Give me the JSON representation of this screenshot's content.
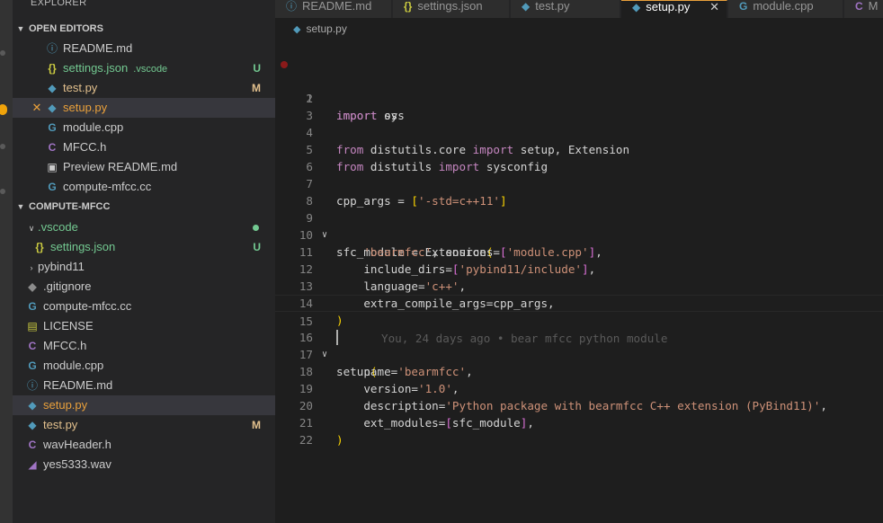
{
  "explorer": {
    "title": "EXPLORER",
    "open_editors_title": "OPEN EDITORS",
    "project_title": "COMPUTE-MFCC",
    "open_editors": [
      {
        "label": "README.md",
        "icon": "info-icon",
        "hint": "",
        "badge": ""
      },
      {
        "label": "settings.json",
        "icon": "json-braces-icon",
        "hint": ".vscode",
        "badge": "U"
      },
      {
        "label": "test.py",
        "icon": "python-icon",
        "hint": "",
        "badge": "M"
      },
      {
        "label": "setup.py",
        "icon": "python-icon",
        "hint": "",
        "badge": ""
      },
      {
        "label": "module.cpp",
        "icon": "cpp-icon",
        "hint": "",
        "badge": ""
      },
      {
        "label": "MFCC.h",
        "icon": "c-header-icon",
        "hint": "",
        "badge": ""
      },
      {
        "label": "Preview README.md",
        "icon": "preview-icon",
        "hint": "",
        "badge": ""
      },
      {
        "label": "compute-mfcc.cc",
        "icon": "cpp-icon",
        "hint": "",
        "badge": ""
      }
    ],
    "files": [
      {
        "label": ".vscode",
        "icon": "chevron-down-icon",
        "badge": ""
      },
      {
        "label": "settings.json",
        "icon": "json-braces-icon",
        "badge": "U"
      },
      {
        "label": "pybind11",
        "icon": "chevron-right-icon",
        "badge": ""
      },
      {
        "label": ".gitignore",
        "icon": "git-icon",
        "badge": ""
      },
      {
        "label": "compute-mfcc.cc",
        "icon": "cpp-icon",
        "badge": ""
      },
      {
        "label": "LICENSE",
        "icon": "license-icon",
        "badge": ""
      },
      {
        "label": "MFCC.h",
        "icon": "c-header-icon",
        "badge": ""
      },
      {
        "label": "module.cpp",
        "icon": "cpp-icon",
        "badge": ""
      },
      {
        "label": "README.md",
        "icon": "info-icon",
        "badge": ""
      },
      {
        "label": "setup.py",
        "icon": "python-icon",
        "badge": ""
      },
      {
        "label": "test.py",
        "icon": "python-icon",
        "badge": "M"
      },
      {
        "label": "wavHeader.h",
        "icon": "c-header-icon",
        "badge": ""
      },
      {
        "label": "yes5333.wav",
        "icon": "audio-icon",
        "badge": ""
      }
    ]
  },
  "tabs": [
    {
      "label": "README.md",
      "icon": "info-icon"
    },
    {
      "label": "settings.json",
      "icon": "json-braces-icon"
    },
    {
      "label": "test.py",
      "icon": "python-icon"
    },
    {
      "label": "setup.py",
      "icon": "python-icon",
      "active": true
    },
    {
      "label": "module.cpp",
      "icon": "cpp-icon"
    },
    {
      "label": "M",
      "icon": "c-header-icon"
    }
  ],
  "breadcrumb": {
    "file": "setup.py"
  },
  "editor": {
    "line_numbers": [
      "1",
      "2",
      "3",
      "4",
      "5",
      "6",
      "7",
      "8",
      "9",
      "10",
      "11",
      "12",
      "13",
      "14",
      "15",
      "16",
      "17",
      "18",
      "19",
      "20",
      "21",
      "22"
    ],
    "blame": "You, 24 days ago • bear mfcc python module",
    "code": {
      "l1a": "import",
      "l1b": " os",
      "l2a": "import",
      "l2b": " sys",
      "l4a": "from",
      "l4b": " distutils.core ",
      "l4c": "import",
      "l4d": " setup, Extension",
      "l5a": "from",
      "l5b": " distutils ",
      "l5c": "import",
      "l5d": " sysconfig",
      "l7a": "cpp_args = ",
      "l7b": "[",
      "l7c": "'-std=c++11'",
      "l7d": "]",
      "l9a": "sfc_module = Extension",
      "l9b": "(",
      "l10a": "    ",
      "l10b": "'bearmfcc'",
      "l10c": ", sources=",
      "l10d": "[",
      "l10e": "'module.cpp'",
      "l10f": "]",
      "l10g": ",",
      "l11a": "    include_dirs=",
      "l11b": "[",
      "l11c": "'pybind11/include'",
      "l11d": "]",
      "l11e": ",",
      "l12a": "    language=",
      "l12b": "'c++'",
      "l12c": ",",
      "l13a": "    extra_compile_args=cpp_args,",
      "l14a": ")",
      "l16a": "setup",
      "l16b": "(",
      "l17a": "    name=",
      "l17b": "'bearmfcc'",
      "l17c": ",",
      "l18a": "    version=",
      "l18b": "'1.0'",
      "l18c": ",",
      "l19a": "    description=",
      "l19b": "'Python package with bearmfcc C++ extension (PyBind11)'",
      "l19c": ",",
      "l20a": "    ext_modules=",
      "l20b": "[",
      "l20c": "sfc_module",
      "l20d": "]",
      "l20e": ",",
      "l21a": ")"
    }
  },
  "colors": {
    "accent": "#e9a03b",
    "keyword": "#c586c0",
    "string": "#ce9178",
    "bracket": "#ffd700",
    "modified": "#e2c08d",
    "untracked": "#73c991"
  }
}
